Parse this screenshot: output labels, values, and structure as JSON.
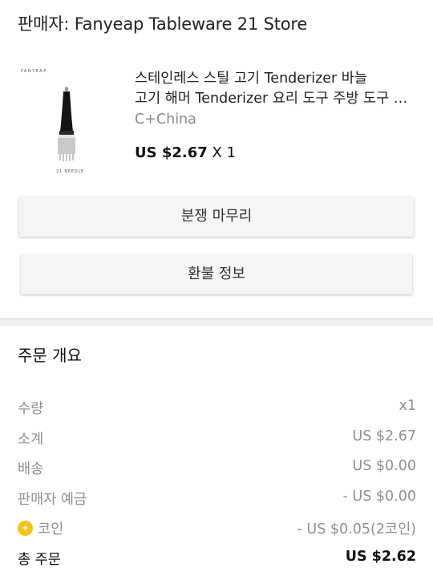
{
  "seller": {
    "label": "판매자: Fanyeap Tableware 21 Store"
  },
  "product": {
    "image_brand": "FANYEAP",
    "image_caption": "21 NEEDLE",
    "title_line1": "스테인레스 스틸 고기 Tenderizer 바늘",
    "title_line2": "고기 해머 Tenderizer 요리 도구 주방 도구 가제트",
    "origin": "C+China",
    "price": "US $2.67",
    "quantity": "X 1"
  },
  "actions": {
    "dispute_label": "분쟁 마무리",
    "refund_label": "환불 정보"
  },
  "summary": {
    "title": "주문 개요",
    "rows": [
      {
        "label": "수량",
        "value": "x1"
      },
      {
        "label": "소계",
        "value": "US $2.67"
      },
      {
        "label": "배송",
        "value": "US $0.00"
      },
      {
        "label": "판매자 예금",
        "value": "- US $0.00"
      },
      {
        "label": "코인",
        "value": "- US $0.05(2코인)",
        "icon": "coin-icon"
      }
    ],
    "total": {
      "label": "총 주문",
      "value": "US $2.62"
    }
  },
  "colors": {
    "muted_text": "#8f8f8f",
    "button_bg": "#f5f5f5",
    "coin": "#f6c21b"
  }
}
